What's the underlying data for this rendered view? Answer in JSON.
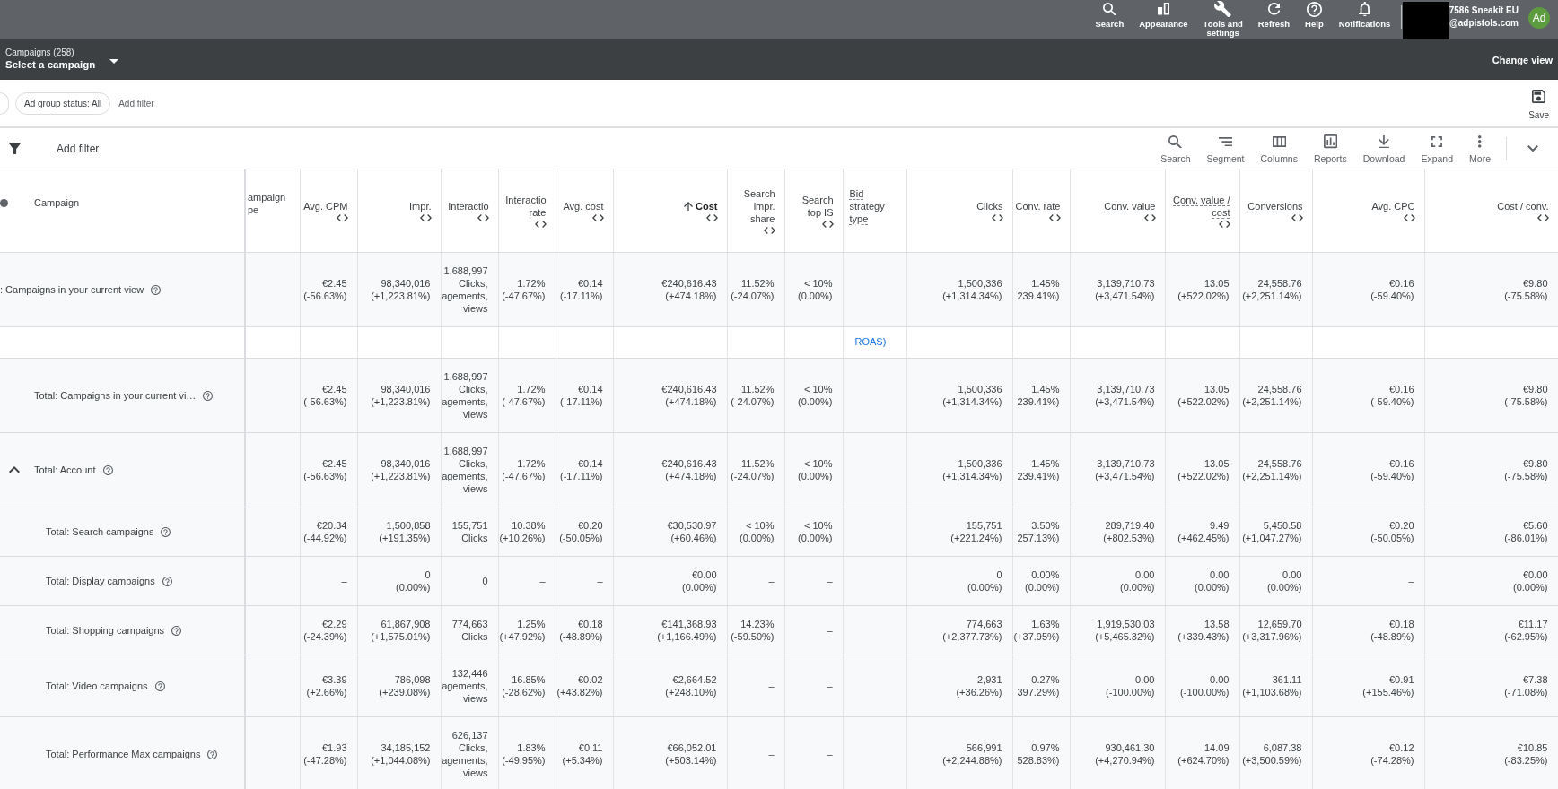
{
  "top_bar": {
    "actions": [
      {
        "label": "Search"
      },
      {
        "label": "Appearance"
      },
      {
        "label": "Tools and\nsettings"
      },
      {
        "label": "Refresh"
      },
      {
        "label": "Help"
      },
      {
        "label": "Notifications"
      }
    ],
    "account": {
      "name": "7586 Sneakit EU",
      "email": "@adpistols.com",
      "avatar": "Ad"
    }
  },
  "campaign_bar": {
    "label": "Campaigns (258)",
    "selector": "Select a campaign",
    "change_view": "Change view"
  },
  "filter_bar": {
    "chips": [
      {
        "label": "Ad group status: All"
      }
    ],
    "add_filter": "Add filter",
    "save": "Save"
  },
  "toolbar": {
    "add_filter": "Add filter",
    "actions": [
      {
        "label": "Search"
      },
      {
        "label": "Segment"
      },
      {
        "label": "Columns"
      },
      {
        "label": "Reports"
      },
      {
        "label": "Download"
      },
      {
        "label": "Expand"
      },
      {
        "label": "More"
      }
    ]
  },
  "table": {
    "campaign_header": "Campaign",
    "columns": [
      {
        "label": "ampaign\npe",
        "kind": "text",
        "sorted": false,
        "hint": false
      },
      {
        "label": "Avg. CPM",
        "kind": "number",
        "sorted": false,
        "hint": false
      },
      {
        "label": "Impr.",
        "kind": "number",
        "sorted": false,
        "hint": false
      },
      {
        "label": "Interactio",
        "kind": "number",
        "sorted": false,
        "hint": false
      },
      {
        "label": "Interactio\nrate",
        "kind": "number",
        "sorted": false,
        "hint": false
      },
      {
        "label": "Avg. cost",
        "kind": "number",
        "sorted": false,
        "hint": false
      },
      {
        "label": "Cost",
        "kind": "number",
        "sorted": true,
        "hint": false
      },
      {
        "label": "Search\nimpr.\nshare",
        "kind": "number",
        "sorted": false,
        "hint": false
      },
      {
        "label": "Search\ntop IS",
        "kind": "number",
        "sorted": false,
        "hint": false
      },
      {
        "label": "Bid\nstrategy\ntype",
        "kind": "strategy",
        "sorted": false,
        "hint": true
      },
      {
        "label": "Clicks",
        "kind": "number",
        "sorted": false,
        "hint": true
      },
      {
        "label": "Conv. rate",
        "kind": "number",
        "sorted": false,
        "hint": true
      },
      {
        "label": "Conv. value",
        "kind": "number",
        "sorted": false,
        "hint": true
      },
      {
        "label": "Conv. value /\ncost",
        "kind": "number",
        "sorted": false,
        "hint": true
      },
      {
        "label": "Conversions",
        "kind": "number",
        "sorted": false,
        "hint": true
      },
      {
        "label": "Avg. CPC",
        "kind": "number",
        "sorted": false,
        "hint": true
      },
      {
        "label": "Cost / conv.",
        "kind": "number",
        "sorted": false,
        "hint": true
      }
    ],
    "rows": [
      {
        "kind": "overlay",
        "name": ": Campaigns in your current view",
        "values": [
          [
            "€2.45",
            "(-56.63%)"
          ],
          [
            "98,340,016",
            "(+1,223.81%)"
          ],
          [
            "1,688,997",
            "Clicks,",
            "agements,",
            "views"
          ],
          [
            "1.72%",
            "(-47.67%)"
          ],
          [
            "€0.14",
            "(-17.11%)"
          ],
          [
            "€240,616.43",
            "(+474.18%)"
          ],
          [
            "11.52%",
            "(-24.07%)"
          ],
          [
            "< 10%",
            "(0.00%)"
          ],
          [
            "1,500,336",
            "(+1,314.34%)"
          ],
          [
            "1.45%",
            "239.41%)"
          ],
          [
            "3,139,710.73",
            "(+3,471.54%)"
          ],
          [
            "13.05",
            "(+522.02%)"
          ],
          [
            "24,558.76",
            "(+2,251.14%)"
          ],
          [
            "€0.16",
            "(-59.40%)"
          ],
          [
            "€9.80",
            "(-75.58%)"
          ]
        ]
      },
      {
        "kind": "strip",
        "bid_strategy_type": "ROAS)"
      },
      {
        "kind": "total",
        "name": "Total: Campaigns in your current vi…",
        "values": [
          [
            "€2.45",
            "(-56.63%)"
          ],
          [
            "98,340,016",
            "(+1,223.81%)"
          ],
          [
            "1,688,997",
            "Clicks,",
            "agements,",
            "views"
          ],
          [
            "1.72%",
            "(-47.67%)"
          ],
          [
            "€0.14",
            "(-17.11%)"
          ],
          [
            "€240,616.43",
            "(+474.18%)"
          ],
          [
            "11.52%",
            "(-24.07%)"
          ],
          [
            "< 10%",
            "(0.00%)"
          ],
          [
            "1,500,336",
            "(+1,314.34%)"
          ],
          [
            "1.45%",
            "239.41%)"
          ],
          [
            "3,139,710.73",
            "(+3,471.54%)"
          ],
          [
            "13.05",
            "(+522.02%)"
          ],
          [
            "24,558.76",
            "(+2,251.14%)"
          ],
          [
            "€0.16",
            "(-59.40%)"
          ],
          [
            "€9.80",
            "(-75.58%)"
          ]
        ]
      },
      {
        "kind": "total",
        "name": "Total: Account",
        "expanded": true,
        "values": [
          [
            "€2.45",
            "(-56.63%)"
          ],
          [
            "98,340,016",
            "(+1,223.81%)"
          ],
          [
            "1,688,997",
            "Clicks,",
            "agements,",
            "views"
          ],
          [
            "1.72%",
            "(-47.67%)"
          ],
          [
            "€0.14",
            "(-17.11%)"
          ],
          [
            "€240,616.43",
            "(+474.18%)"
          ],
          [
            "11.52%",
            "(-24.07%)"
          ],
          [
            "< 10%",
            "(0.00%)"
          ],
          [
            "1,500,336",
            "(+1,314.34%)"
          ],
          [
            "1.45%",
            "239.41%)"
          ],
          [
            "3,139,710.73",
            "(+3,471.54%)"
          ],
          [
            "13.05",
            "(+522.02%)"
          ],
          [
            "24,558.76",
            "(+2,251.14%)"
          ],
          [
            "€0.16",
            "(-59.40%)"
          ],
          [
            "€9.80",
            "(-75.58%)"
          ]
        ],
        "children": [
          {
            "kind": "total",
            "name": "Total: Search campaigns",
            "values": [
              [
                "€20.34",
                "(-44.92%)"
              ],
              [
                "1,500,858",
                "(+191.35%)"
              ],
              [
                "155,751",
                "Clicks"
              ],
              [
                "10.38%",
                "(+10.26%)"
              ],
              [
                "€0.20",
                "(-50.05%)"
              ],
              [
                "€30,530.97",
                "(+60.46%)"
              ],
              [
                "< 10%",
                "(0.00%)"
              ],
              [
                "< 10%",
                "(0.00%)"
              ],
              [
                "155,751",
                "(+221.24%)"
              ],
              [
                "3.50%",
                "257.13%)"
              ],
              [
                "289,719.40",
                "(+802.53%)"
              ],
              [
                "9.49",
                "(+462.45%)"
              ],
              [
                "5,450.58",
                "(+1,047.27%)"
              ],
              [
                "€0.20",
                "(-50.05%)"
              ],
              [
                "€5.60",
                "(-86.01%)"
              ]
            ]
          },
          {
            "kind": "total",
            "name": "Total: Display campaigns",
            "values": [
              [
                "–"
              ],
              [
                "0",
                "(0.00%)"
              ],
              [
                "0"
              ],
              [
                "–"
              ],
              [
                "–"
              ],
              [
                "€0.00",
                "(0.00%)"
              ],
              [
                "–"
              ],
              [
                "–"
              ],
              [
                "0",
                "(0.00%)"
              ],
              [
                "0.00%",
                "(0.00%)"
              ],
              [
                "0.00",
                "(0.00%)"
              ],
              [
                "0.00",
                "(0.00%)"
              ],
              [
                "0.00",
                "(0.00%)"
              ],
              [
                "–"
              ],
              [
                "€0.00",
                "(0.00%)"
              ]
            ]
          },
          {
            "kind": "total",
            "name": "Total: Shopping campaigns",
            "values": [
              [
                "€2.29",
                "(-24.39%)"
              ],
              [
                "61,867,908",
                "(+1,575.01%)"
              ],
              [
                "774,663",
                "Clicks"
              ],
              [
                "1.25%",
                "(+47.92%)"
              ],
              [
                "€0.18",
                "(-48.89%)"
              ],
              [
                "€141,368.93",
                "(+1,166.49%)"
              ],
              [
                "14.23%",
                "(-59.50%)"
              ],
              [
                "–"
              ],
              [
                "774,663",
                "(+2,377.73%)"
              ],
              [
                "1.63%",
                "(+37.95%)"
              ],
              [
                "1,919,530.03",
                "(+5,465.32%)"
              ],
              [
                "13.58",
                "(+339.43%)"
              ],
              [
                "12,659.70",
                "(+3,317.96%)"
              ],
              [
                "€0.18",
                "(-48.89%)"
              ],
              [
                "€11.17",
                "(-62.95%)"
              ]
            ]
          },
          {
            "kind": "total",
            "name": "Total: Video campaigns",
            "values": [
              [
                "€3.39",
                "(+2.66%)"
              ],
              [
                "786,098",
                "(+239.08%)"
              ],
              [
                "132,446",
                "agements,",
                "views"
              ],
              [
                "16.85%",
                "(-28.62%)"
              ],
              [
                "€0.02",
                "(+43.82%)"
              ],
              [
                "€2,664.52",
                "(+248.10%)"
              ],
              [
                "–"
              ],
              [
                "–"
              ],
              [
                "2,931",
                "(+36.26%)"
              ],
              [
                "0.27%",
                "397.29%)"
              ],
              [
                "0.00",
                "(-100.00%)"
              ],
              [
                "0.00",
                "(-100.00%)"
              ],
              [
                "361.11",
                "(+1,103.68%)"
              ],
              [
                "€0.91",
                "(+155.46%)"
              ],
              [
                "€7.38",
                "(-71.08%)"
              ]
            ]
          },
          {
            "kind": "total",
            "name": "Total: Performance Max campaigns",
            "values": [
              [
                "€1.93",
                "(-47.28%)"
              ],
              [
                "34,185,152",
                "(+1,044.08%)"
              ],
              [
                "626,137",
                "Clicks,",
                "agements,",
                "views"
              ],
              [
                "1.83%",
                "(-49.95%)"
              ],
              [
                "€0.11",
                "(+5.34%)"
              ],
              [
                "€66,052.01",
                "(+503.14%)"
              ],
              [
                "–"
              ],
              [
                "–"
              ],
              [
                "566,991",
                "(+2,244.88%)"
              ],
              [
                "0.97%",
                "528.83%)"
              ],
              [
                "930,461.30",
                "(+4,270.94%)"
              ],
              [
                "14.09",
                "(+624.70%)"
              ],
              [
                "6,087.38",
                "(+3,500.59%)"
              ],
              [
                "€0.12",
                "(-74.28%)"
              ],
              [
                "€10.85",
                "(-83.25%)"
              ]
            ]
          }
        ]
      }
    ]
  }
}
